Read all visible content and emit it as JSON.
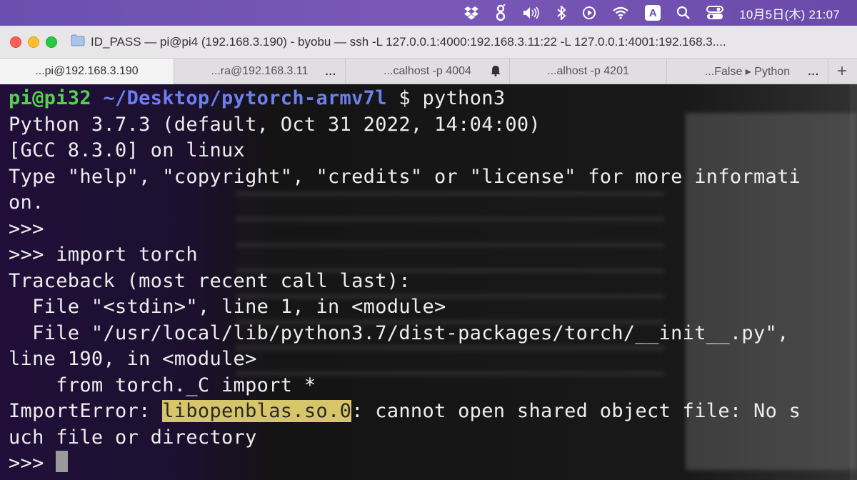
{
  "menubar": {
    "input_badge": "A",
    "clock": "10月5日(木) 21:07"
  },
  "window": {
    "title": "ID_PASS — pi@pi4 (192.168.3.190) - byobu — ssh -L 127.0.0.1:4000:192.168.3.11:22 -L 127.0.0.1:4001:192.168.3...."
  },
  "tabs": [
    {
      "label": "...pi@192.168.3.190"
    },
    {
      "label": "...ra@192.168.3.11",
      "more": "..."
    },
    {
      "label": "...calhost -p 4004"
    },
    {
      "label": "...alhost -p 4201"
    },
    {
      "label": "...False ▸ Python",
      "more": "..."
    }
  ],
  "tab_add": "+",
  "terminal": {
    "prompt_user": "pi@pi32",
    "prompt_path": "~/Desktop/pytorch-armv7l",
    "prompt_symbol": "$",
    "command": "python3",
    "lines": [
      "Python 3.7.3 (default, Oct 31 2022, 14:04:00)",
      "[GCC 8.3.0] on linux",
      "Type \"help\", \"copyright\", \"credits\" or \"license\" for more informati",
      "on.",
      ">>>",
      ">>> import torch",
      "Traceback (most recent call last):",
      "  File \"<stdin>\", line 1, in <module>",
      "  File \"/usr/local/lib/python3.7/dist-packages/torch/__init__.py\",",
      "line 190, in <module>",
      "    from torch._C import *"
    ],
    "error_prefix": "ImportError: ",
    "error_highlight": "libopenblas.so.0",
    "error_rest": ": cannot open shared object file: No s",
    "error_cont": "uch file or directory",
    "final_prompt": ">>> "
  }
}
